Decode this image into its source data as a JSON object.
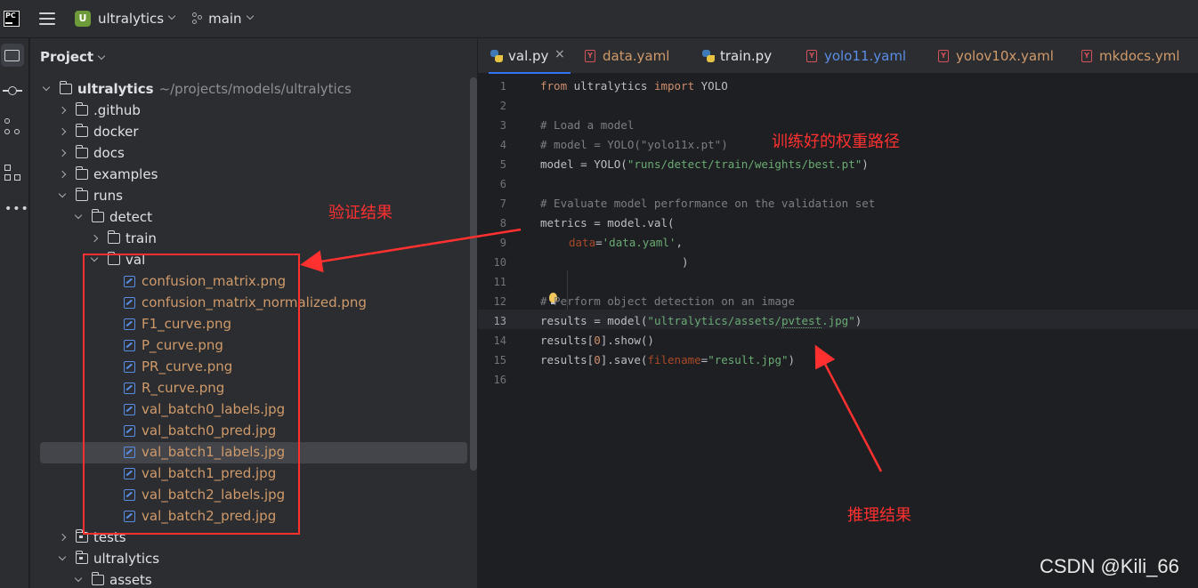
{
  "topbar": {
    "project_badge": "U",
    "project_name": "ultralytics",
    "branch": "main"
  },
  "project_panel": {
    "title": "Project",
    "root_name": "ultralytics",
    "root_path": "~/projects/models/ultralytics",
    "tree": [
      {
        "label": "ultralytics",
        "type": "root",
        "depth": 0,
        "state": "open"
      },
      {
        "label": ".github",
        "type": "dir",
        "depth": 1,
        "state": "closed"
      },
      {
        "label": "docker",
        "type": "dir",
        "depth": 1,
        "state": "closed"
      },
      {
        "label": "docs",
        "type": "dir",
        "depth": 1,
        "state": "closed"
      },
      {
        "label": "examples",
        "type": "dir",
        "depth": 1,
        "state": "closed"
      },
      {
        "label": "runs",
        "type": "dir",
        "depth": 1,
        "state": "open"
      },
      {
        "label": "detect",
        "type": "dir",
        "depth": 2,
        "state": "open"
      },
      {
        "label": "train",
        "type": "dir",
        "depth": 3,
        "state": "closed"
      },
      {
        "label": "val",
        "type": "dir",
        "depth": 3,
        "state": "open"
      },
      {
        "label": "confusion_matrix.png",
        "type": "file",
        "depth": 4
      },
      {
        "label": "confusion_matrix_normalized.png",
        "type": "file",
        "depth": 4
      },
      {
        "label": "F1_curve.png",
        "type": "file",
        "depth": 4
      },
      {
        "label": "P_curve.png",
        "type": "file",
        "depth": 4
      },
      {
        "label": "PR_curve.png",
        "type": "file",
        "depth": 4
      },
      {
        "label": "R_curve.png",
        "type": "file",
        "depth": 4
      },
      {
        "label": "val_batch0_labels.jpg",
        "type": "file",
        "depth": 4
      },
      {
        "label": "val_batch0_pred.jpg",
        "type": "file",
        "depth": 4
      },
      {
        "label": "val_batch1_labels.jpg",
        "type": "file",
        "depth": 4,
        "selected": true
      },
      {
        "label": "val_batch1_pred.jpg",
        "type": "file",
        "depth": 4
      },
      {
        "label": "val_batch2_labels.jpg",
        "type": "file",
        "depth": 4
      },
      {
        "label": "val_batch2_pred.jpg",
        "type": "file",
        "depth": 4
      },
      {
        "label": "tests",
        "type": "pkg",
        "depth": 1,
        "state": "closed"
      },
      {
        "label": "ultralytics",
        "type": "pkg",
        "depth": 1,
        "state": "open"
      },
      {
        "label": "assets",
        "type": "dir",
        "depth": 2,
        "state": "open"
      }
    ]
  },
  "editor": {
    "tabs": [
      {
        "label": "val.py",
        "kind": "py",
        "active": true,
        "close": "×"
      },
      {
        "label": "data.yaml",
        "kind": "yml"
      },
      {
        "label": "train.py",
        "kind": "py"
      },
      {
        "label": "yolo11.yaml",
        "kind": "yml",
        "highlight": true
      },
      {
        "label": "yolov10x.yaml",
        "kind": "yml"
      },
      {
        "label": "mkdocs.yml",
        "kind": "yml"
      }
    ],
    "line_numbers": [
      "1",
      "2",
      "3",
      "4",
      "5",
      "6",
      "7",
      "8",
      "9",
      "10",
      "11",
      "12",
      "13",
      "14",
      "15",
      "16"
    ],
    "current_line": 13,
    "code": {
      "l1_kw1": "from",
      "l1_mod": " ultralytics ",
      "l1_kw2": "import",
      "l1_name": " YOLO",
      "l3": "# Load a model",
      "l4": "# model = YOLO(\"yolo11x.pt\")",
      "l5_a": "model = YOLO(",
      "l5_s": "\"runs/detect/train/weights/best.pt\"",
      "l5_b": ")",
      "l7": "# Evaluate model performance on the validation set",
      "l8": "metrics = model.val(",
      "l9_p": "data",
      "l9_eq": "=",
      "l9_s": "'data.yaml'",
      "l9_c": ",",
      "l10": ")",
      "l12": "# Perform object detection on an image",
      "l13_a": "results = model(",
      "l13_s1": "\"ultralytics/assets/",
      "l13_s2": "pvtest",
      "l13_s3": ".jpg\"",
      "l13_b": ")",
      "l14_a": "results[",
      "l14_n": "0",
      "l14_b": "].show()",
      "l15_a": "results[",
      "l15_n": "0",
      "l15_b": "].save(",
      "l15_p": "filename",
      "l15_eq": "=",
      "l15_s": "\"result.jpg\"",
      "l15_c": ")"
    }
  },
  "annotations": {
    "weights": "训练好的权重路径",
    "validation": "验证结果",
    "inference": "推理结果",
    "color": "#ff3030"
  },
  "watermark": "CSDN @Kili_66"
}
